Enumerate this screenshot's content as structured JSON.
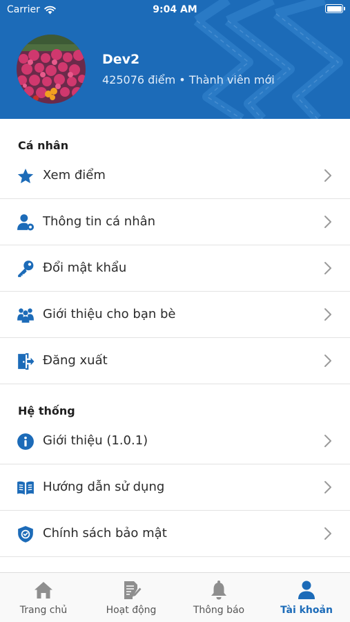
{
  "status_bar": {
    "carrier": "Carrier",
    "time": "9:04 AM"
  },
  "profile": {
    "name": "Dev2",
    "points": "425076 điểm",
    "separator": "•",
    "rank": "Thành viên mới"
  },
  "sections": [
    {
      "title": "Cá nhân",
      "items": [
        {
          "label": "Xem điểm",
          "icon": "star-icon"
        },
        {
          "label": "Thông tin cá nhân",
          "icon": "user-settings-icon"
        },
        {
          "label": "Đổi mật khẩu",
          "icon": "key-icon"
        },
        {
          "label": "Giới thiệu cho bạn bè",
          "icon": "users-icon"
        },
        {
          "label": "Đăng xuất",
          "icon": "logout-icon"
        }
      ]
    },
    {
      "title": "Hệ thống",
      "items": [
        {
          "label": "Giới thiệu (1.0.1)",
          "icon": "info-icon"
        },
        {
          "label": "Hướng dẫn sử dụng",
          "icon": "book-icon"
        },
        {
          "label": "Chính sách bảo mật",
          "icon": "shield-icon"
        }
      ]
    }
  ],
  "tabs": [
    {
      "label": "Trang chủ",
      "icon": "home-icon",
      "active": false
    },
    {
      "label": "Hoạt động",
      "icon": "activity-icon",
      "active": false
    },
    {
      "label": "Thông báo",
      "icon": "bell-icon",
      "active": false
    },
    {
      "label": "Tài khoản",
      "icon": "account-icon",
      "active": true
    }
  ],
  "colors": {
    "accent": "#1c6bb8",
    "header": "#1c6bb8",
    "inactive_tab": "#8e8e8e"
  }
}
